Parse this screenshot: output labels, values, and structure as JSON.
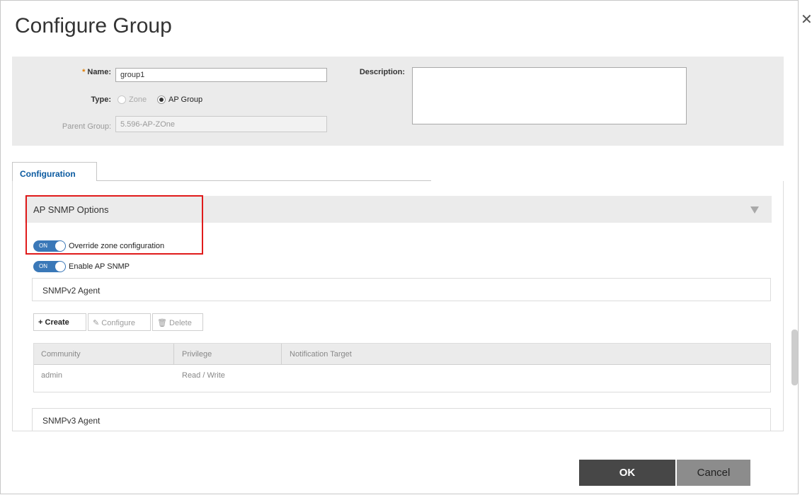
{
  "dialog": {
    "title": "Configure Group",
    "close_icon": "close-icon"
  },
  "form": {
    "name_label": "Name:",
    "name_required_marker": "*",
    "name_value": "group1",
    "type_label": "Type:",
    "type_options": [
      {
        "label": "Zone",
        "selected": false,
        "disabled": true
      },
      {
        "label": "AP Group",
        "selected": true,
        "disabled": false
      }
    ],
    "parent_group_label": "Parent Group:",
    "parent_group_value": "5.596-AP-ZOne",
    "description_label": "Description:",
    "description_value": ""
  },
  "tabs": [
    {
      "label": "Configuration",
      "active": true
    }
  ],
  "section": {
    "title": "AP SNMP Options",
    "collapse_icon": "triangle-down-icon",
    "override_toggle": {
      "state": "ON",
      "label": "Override zone configuration"
    },
    "enable_toggle": {
      "state": "ON",
      "label": "Enable AP SNMP"
    },
    "snmpv2": {
      "title": "SNMPv2 Agent",
      "toolbar": {
        "create_label": "Create",
        "configure_label": "Configure",
        "delete_label": "Delete"
      },
      "table": {
        "columns": [
          "Community",
          "Privilege",
          "Notification Target"
        ],
        "rows": [
          [
            "admin",
            "Read / Write",
            ""
          ]
        ]
      }
    },
    "snmpv3": {
      "title": "SNMPv3 Agent"
    }
  },
  "footer": {
    "ok_label": "OK",
    "cancel_label": "Cancel"
  },
  "colors": {
    "toggle_on": "#3a78b8",
    "highlight_border": "#e01b1b",
    "tab_text": "#0a5aa0",
    "ok_bg": "#474747",
    "cancel_bg": "#8c8c8c"
  }
}
